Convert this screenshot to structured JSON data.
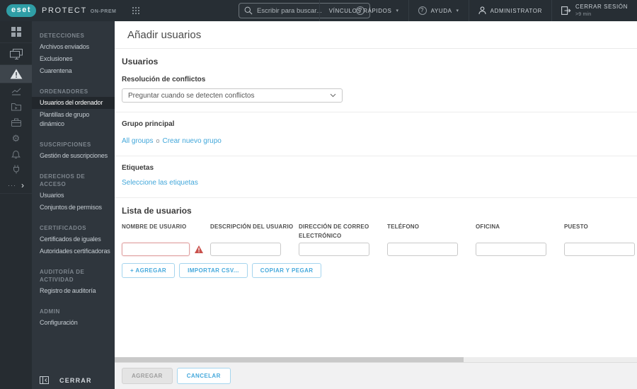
{
  "topbar": {
    "logo_text": "eset",
    "product_name": "PROTECT",
    "product_edition": "ON-PREM",
    "search_placeholder": "Escribir para buscar...",
    "quick_links_label": "VÍNCULOS RÁPIDOS",
    "help_label": "AYUDA",
    "user_label": "ADMINISTRATOR",
    "logout_label": "CERRAR SESIÓN",
    "logout_timer": ">9 min"
  },
  "icons": {
    "caret_down": "▾",
    "question_mark": "?",
    "more_dots": "···",
    "more_chevron": "›",
    "gear": "⚙"
  },
  "sidebar": {
    "sections": [
      {
        "header": "DETECCIONES",
        "items": [
          {
            "label": "Archivos enviados"
          },
          {
            "label": "Exclusiones"
          },
          {
            "label": "Cuarentena"
          }
        ]
      },
      {
        "header": "ORDENADORES",
        "items": [
          {
            "label": "Usuarios del ordenador",
            "selected": true
          },
          {
            "label": "Plantillas de grupo dinámico"
          }
        ]
      },
      {
        "header": "SUSCRIPCIONES",
        "items": [
          {
            "label": "Gestión de suscripciones"
          }
        ]
      },
      {
        "header": "DERECHOS DE ACCESO",
        "items": [
          {
            "label": "Usuarios"
          },
          {
            "label": "Conjuntos de permisos"
          }
        ]
      },
      {
        "header": "CERTIFICADOS",
        "items": [
          {
            "label": "Certificados de iguales"
          },
          {
            "label": "Autoridades certificadoras"
          }
        ]
      },
      {
        "header": "AUDITORÍA DE ACTIVIDAD",
        "items": [
          {
            "label": "Registro de auditoría"
          }
        ]
      },
      {
        "header": "ADMIN",
        "items": [
          {
            "label": "Configuración"
          }
        ]
      }
    ],
    "collapse_label": "CERRAR"
  },
  "main": {
    "title": "Añadir usuarios",
    "users_section_title": "Usuarios",
    "conflict_label": "Resolución de conflictos",
    "conflict_value": "Preguntar cuando se detecten conflictos",
    "group_label": "Grupo principal",
    "group_current": "All groups",
    "group_separator": "o",
    "group_create": "Crear nuevo grupo",
    "tags_label": "Etiquetas",
    "tags_link": "Seleccione las etiquetas",
    "list_title": "Lista de usuarios",
    "table_headers": [
      "NOMBRE DE USUARIO",
      "DESCRIPCIÓN DEL USUARIO",
      "DIRECCIÓN DE CORREO ELECTRÓNICO",
      "TELÉFONO",
      "OFICINA",
      "PUESTO"
    ],
    "add_row_button": "+ AGREGAR",
    "import_csv_button": "IMPORTAR CSV...",
    "copy_paste_button": "COPIAR Y PEGAR"
  },
  "footer": {
    "add_button": "AGREGAR",
    "cancel_button": "CANCELAR"
  },
  "colors": {
    "topbar_bg": "#272e34",
    "rail_bg": "#262c31",
    "submenu_bg": "#2f363d",
    "accent_blue": "#46a9dc",
    "error_red": "#c9514c",
    "logo_teal": "#2f9ea6"
  }
}
